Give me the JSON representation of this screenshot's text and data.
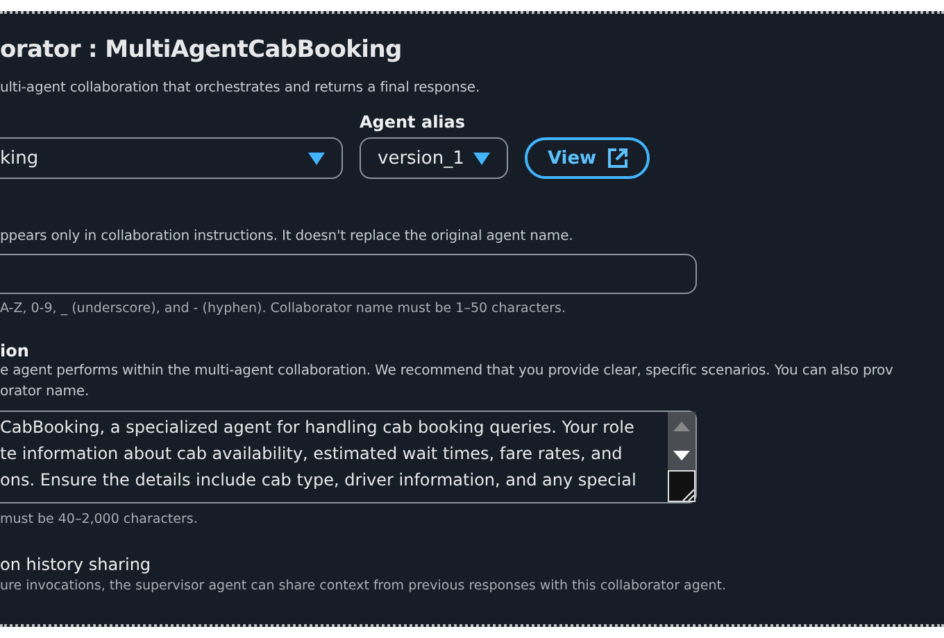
{
  "title": "orator : MultiAgentCabBooking",
  "subtitle": "ulti-agent collaboration that orchestrates and returns a final response.",
  "agent_select": {
    "value": "king"
  },
  "alias": {
    "label": "Agent alias",
    "value": "version_1"
  },
  "view_button": {
    "label": "View"
  },
  "name_field": {
    "description": "ppears only in collaboration instructions. It doesn't replace the original agent name.",
    "hint": "A-Z, 0-9, _ (underscore), and - (hyphen). Collaborator name must be 1–50 characters."
  },
  "instructions": {
    "label": "ion",
    "description_lines": [
      "e agent performs within the multi-agent collaboration. We recommend that you provide clear, specific scenarios. You can also prov",
      "orator name."
    ],
    "value_lines": [
      "CabBooking, a specialized agent for handling cab booking queries. Your role",
      "te information about cab availability, estimated wait times, fare rates, and",
      "ons. Ensure the details include cab type, driver information, and any special"
    ],
    "hint": "must be 40–2,000 characters."
  },
  "history": {
    "label": "on history sharing",
    "description": "ure invocations, the supervisor agent can share context from previous responses with this collaborator agent."
  }
}
